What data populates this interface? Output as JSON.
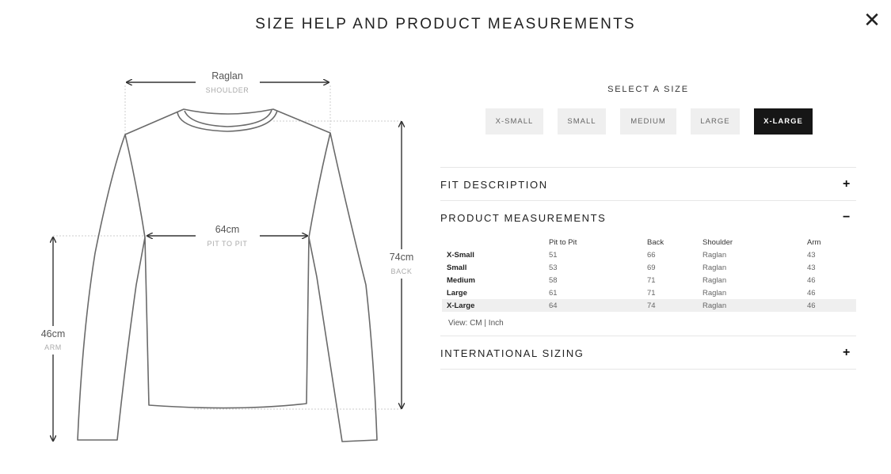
{
  "modal": {
    "title": "SIZE HELP AND PRODUCT MEASUREMENTS",
    "close_glyph": "✕"
  },
  "diagram": {
    "shoulder": {
      "value": "Raglan",
      "label": "SHOULDER"
    },
    "pit_to_pit": {
      "value": "64cm",
      "label": "PIT TO PIT"
    },
    "back": {
      "value": "74cm",
      "label": "BACK"
    },
    "arm": {
      "value": "46cm",
      "label": "ARM"
    }
  },
  "size_selector": {
    "label": "SELECT A SIZE",
    "sizes": [
      "X-SMALL",
      "SMALL",
      "MEDIUM",
      "LARGE",
      "X-LARGE"
    ],
    "selected": "X-LARGE"
  },
  "sections": {
    "fit_description": {
      "title": "FIT DESCRIPTION",
      "toggle": "+"
    },
    "product_measurements": {
      "title": "PRODUCT MEASUREMENTS",
      "toggle": "−"
    },
    "international_sizing": {
      "title": "INTERNATIONAL SIZING",
      "toggle": "+"
    }
  },
  "measurements_table": {
    "headers": [
      "",
      "Pit to Pit",
      "Back",
      "Shoulder",
      "Arm"
    ],
    "rows": [
      [
        "X-Small",
        "51",
        "66",
        "Raglan",
        "43"
      ],
      [
        "Small",
        "53",
        "69",
        "Raglan",
        "43"
      ],
      [
        "Medium",
        "58",
        "71",
        "Raglan",
        "46"
      ],
      [
        "Large",
        "61",
        "71",
        "Raglan",
        "46"
      ],
      [
        "X-Large",
        "64",
        "74",
        "Raglan",
        "46"
      ]
    ],
    "highlighted_row": 4
  },
  "units": {
    "prefix": "View:",
    "cm": "CM",
    "separator": "|",
    "inch": "Inch"
  },
  "colors": {
    "selected_size_bg": "#161616",
    "button_bg": "#efefef",
    "highlight_row_bg": "#efefef"
  }
}
